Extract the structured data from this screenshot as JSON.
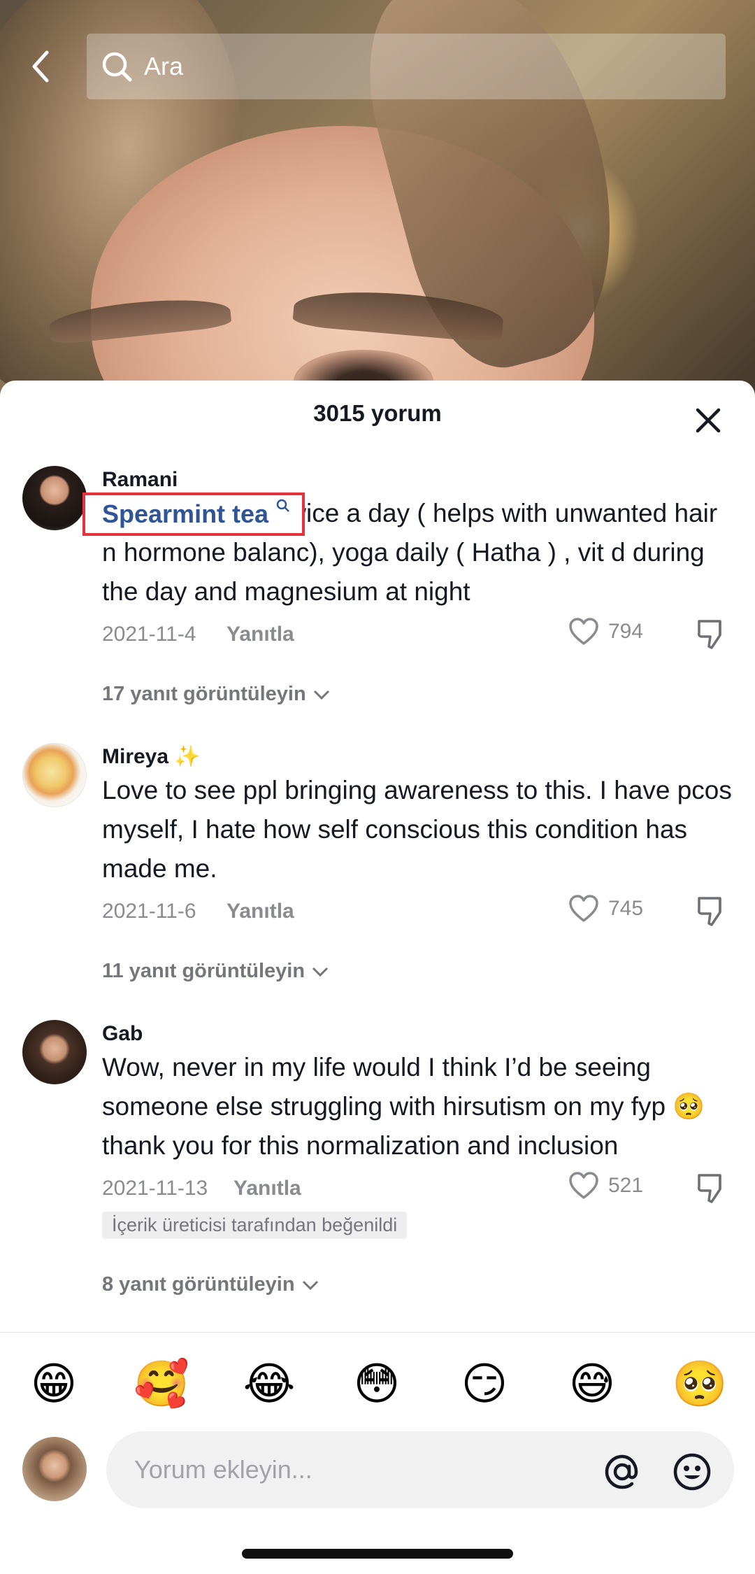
{
  "search": {
    "placeholder": "Ara"
  },
  "sheet": {
    "title": "3015 yorum"
  },
  "comments": [
    {
      "username": "Ramani",
      "highlight": "Spearmint tea",
      "text": "twice a day ( helps with unwanted hair n hormone balanc), yoga daily ( Hatha ) , vit d during the day and magnesium at night",
      "date": "2021-11-4",
      "reply_label": "Yanıtla",
      "likes": "794",
      "view_replies": "17 yanıt görüntüleyin"
    },
    {
      "username": "Mireya",
      "username_emoji": "✨",
      "text": "Love to see ppl bringing awareness to this. I have pcos myself, I hate how self conscious this condition has made me.",
      "date": "2021-11-6",
      "reply_label": "Yanıtla",
      "likes": "745",
      "view_replies": "11 yanıt görüntüleyin"
    },
    {
      "username": "Gab",
      "text": "Wow, never in my life would I think I’d be seeing someone else struggling with hirsutism on my fyp",
      "text_emoji": "🥺",
      "text_tail": "thank you for this normalization and inclusion",
      "date": "2021-11-13",
      "reply_label": "Yanıtla",
      "likes": "521",
      "creator_badge": "İçerik üreticisi tarafından beğenildi",
      "view_replies": "8 yanıt görüntüleyin"
    }
  ],
  "quick_emojis": [
    "😁",
    "🥰",
    "😂",
    "😳",
    "😏",
    "😅",
    "🥺"
  ],
  "composer": {
    "placeholder": "Yorum ekleyin..."
  },
  "colors": {
    "link": "#2f5597",
    "highlight_border": "#e5323e",
    "muted": "#8a8b91"
  }
}
